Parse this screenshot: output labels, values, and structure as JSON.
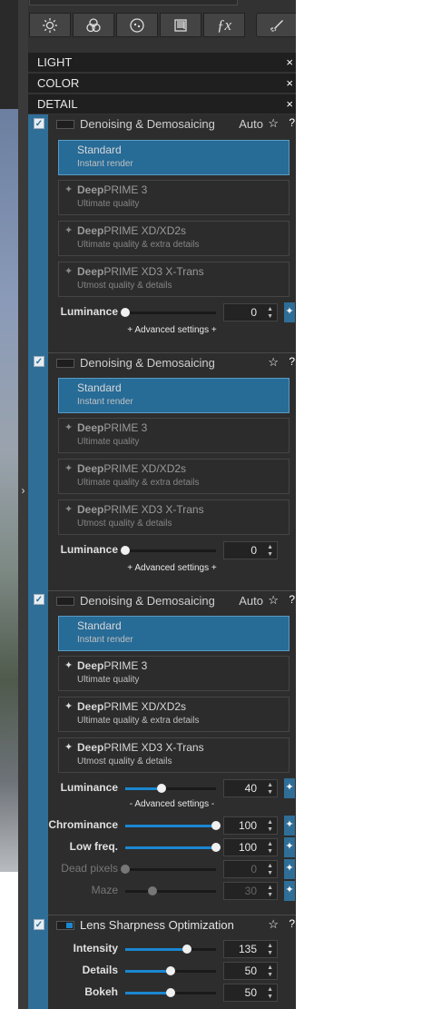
{
  "sections": [
    "LIGHT",
    "COLOR",
    "DETAIL"
  ],
  "close_glyph": "×",
  "tabs": [
    {
      "icon": "sun-icon"
    },
    {
      "icon": "color-circles-icon"
    },
    {
      "icon": "lens-icon"
    },
    {
      "icon": "geometry-icon"
    },
    {
      "icon": "fx-icon",
      "label": "ƒx"
    },
    {
      "icon": "brush-icon"
    }
  ],
  "modules": [
    {
      "title": "Denoising & Demosaicing",
      "auto": "Auto",
      "options": [
        {
          "name": "Standard",
          "sub": "Instant render"
        },
        {
          "bold": "Deep",
          "name": "PRIME 3",
          "sub": "Ultimate quality"
        },
        {
          "bold": "Deep",
          "name": "PRIME XD/XD2s",
          "sub": "Ultimate quality & extra details"
        },
        {
          "bold": "Deep",
          "name": "PRIME XD3 X-Trans",
          "sub": "Utmost quality & details"
        }
      ],
      "luminance_label": "Luminance",
      "luminance": "0",
      "advanced": "+ Advanced settings +"
    },
    {
      "title": "Denoising & Demosaicing",
      "auto": "",
      "options": [
        {
          "name": "Standard",
          "sub": "Instant render"
        },
        {
          "bold": "Deep",
          "name": "PRIME 3",
          "sub": "Ultimate quality"
        },
        {
          "bold": "Deep",
          "name": "PRIME XD/XD2s",
          "sub": "Ultimate quality & extra details"
        },
        {
          "bold": "Deep",
          "name": "PRIME XD3 X-Trans",
          "sub": "Utmost quality & details"
        }
      ],
      "luminance_label": "Luminance",
      "luminance": "0",
      "advanced": "+ Advanced settings +"
    },
    {
      "title": "Denoising & Demosaicing",
      "auto": "Auto",
      "options": [
        {
          "name": "Standard",
          "sub": "Instant render"
        },
        {
          "bold": "Deep",
          "name": "PRIME 3",
          "sub": "Ultimate quality"
        },
        {
          "bold": "Deep",
          "name": "PRIME XD/XD2s",
          "sub": "Ultimate quality & extra details"
        },
        {
          "bold": "Deep",
          "name": "PRIME XD3 X-Trans",
          "sub": "Utmost quality & details"
        }
      ],
      "luminance_label": "Luminance",
      "luminance": "40",
      "luminance_level": 0.4,
      "advanced": "- Advanced settings -",
      "sliders": [
        {
          "label": "Chrominance",
          "value": "100",
          "level": 1.0
        },
        {
          "label": "Low freq.",
          "value": "100",
          "level": 1.0
        },
        {
          "label": "Dead pixels",
          "value": "0",
          "level": 0.0
        },
        {
          "label": "Maze",
          "value": "30",
          "level": 0.3
        }
      ]
    }
  ],
  "lens": {
    "title": "Lens Sharpness Optimization",
    "sliders": [
      {
        "label": "Intensity",
        "value": "135",
        "level": 0.675
      },
      {
        "label": "Details",
        "value": "50",
        "level": 0.5
      },
      {
        "label": "Bokeh",
        "value": "50",
        "level": 0.5
      }
    ]
  },
  "symbols": {
    "star": "☆",
    "help": "?",
    "check": "✓",
    "wand": "✦",
    "up": "▲",
    "down": "▼",
    "collapse": "›",
    "spark": "✦"
  },
  "colors": {
    "accent": "#2f6e97",
    "slider_blue": "#1a87d1",
    "selected": "#276b97"
  }
}
